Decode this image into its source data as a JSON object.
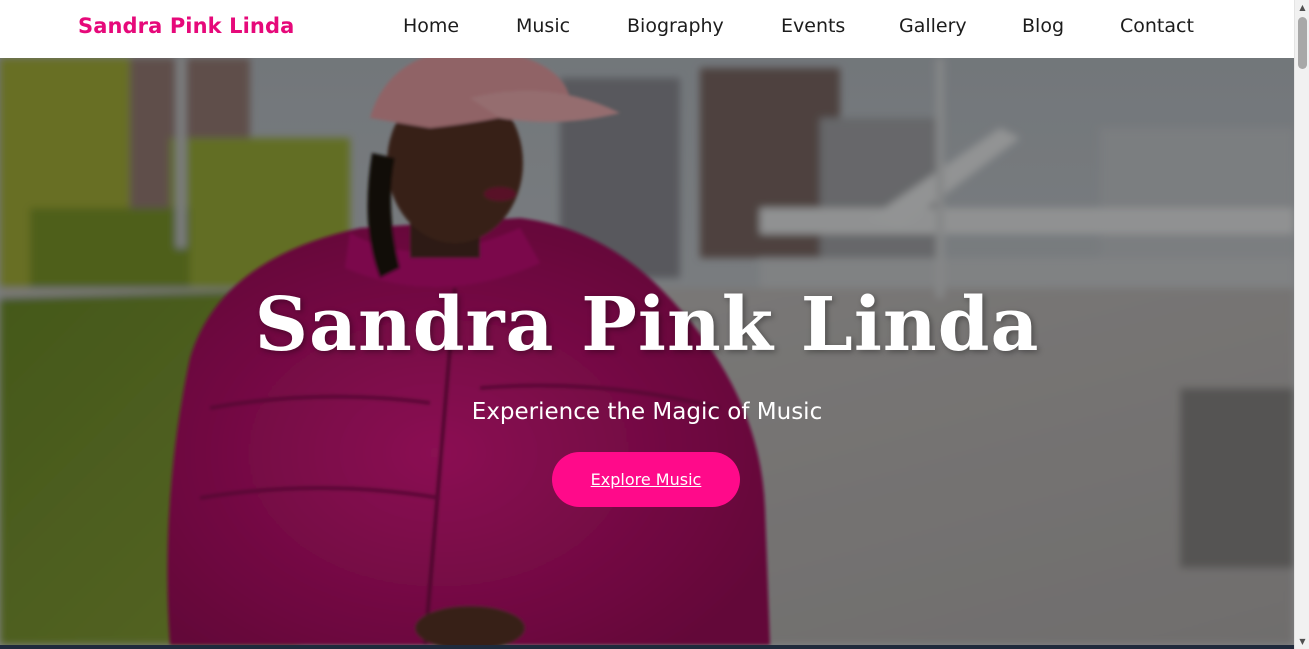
{
  "brand": "Sandra Pink Linda",
  "nav": {
    "home": "Home",
    "music": "Music",
    "biography": "Biography",
    "events": "Events",
    "gallery": "Gallery",
    "blog": "Blog",
    "contact": "Contact"
  },
  "hero": {
    "title": "Sandra Pink Linda",
    "subtitle": "Experience the Magic of Music",
    "button_label": "Explore Music"
  },
  "colors": {
    "brand": "#e6097a",
    "button": "#ff0a8a",
    "nav_text": "#1c1c1c"
  },
  "icons": {
    "scroll_up": "triangle-up-icon",
    "scroll_down": "triangle-down-icon"
  }
}
